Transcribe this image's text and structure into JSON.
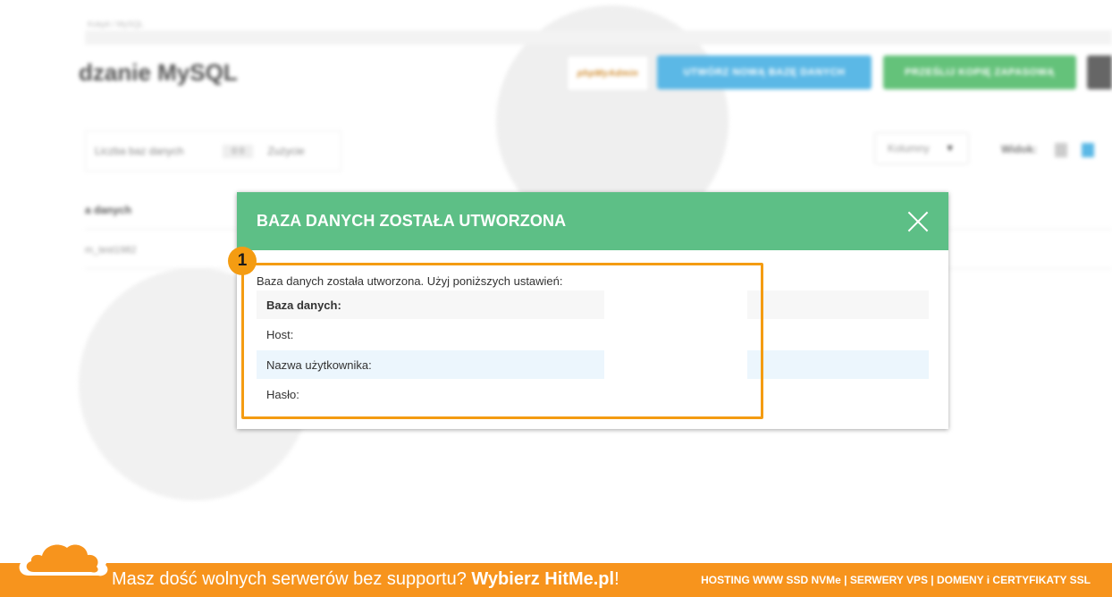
{
  "background": {
    "breadcrumb": "Kokpit / MySQL",
    "page_title": "dzanie MySQL",
    "buttons": {
      "logo_label": "phpMyAdmin",
      "create_db": "UTWÓRZ NOWĄ BAZĘ DANYCH",
      "upload_backup": "PRZEŚLIJ KOPIĘ ZAPASOWĄ"
    },
    "stats": {
      "count_label": "Liczba baz danych",
      "count_value": "0 0",
      "usage_label": "Zużycie"
    },
    "columns_dropdown": "Kolumny",
    "view_label": "Widok:",
    "table_header": "a danych",
    "table_row": "m_test1982"
  },
  "modal": {
    "title": "BAZA DANYCH ZOSTAŁA UTWORZONA",
    "intro": "Baza danych została utworzona. Użyj poniższych ustawień:",
    "rows": [
      {
        "label": "Baza danych:"
      },
      {
        "label": "Host:"
      },
      {
        "label": "Nazwa użytkownika:"
      },
      {
        "label": "Hasło:"
      }
    ]
  },
  "annotation": {
    "badge_number": "1",
    "color": "#f49c12"
  },
  "footer": {
    "promo_text": "Masz dość wolnych serwerów bez supportu? ",
    "promo_bold": "Wybierz HitMe.pl",
    "promo_end": "!",
    "right_links": "HOSTING WWW SSD NVMe | SERWERY VPS | DOMENY i CERTYFIKATY SSL",
    "accent_color": "#f7941d"
  },
  "colors": {
    "modal_header": "#5dbf86",
    "button_blue": "#5bb8e6",
    "button_green": "#64c27a"
  }
}
